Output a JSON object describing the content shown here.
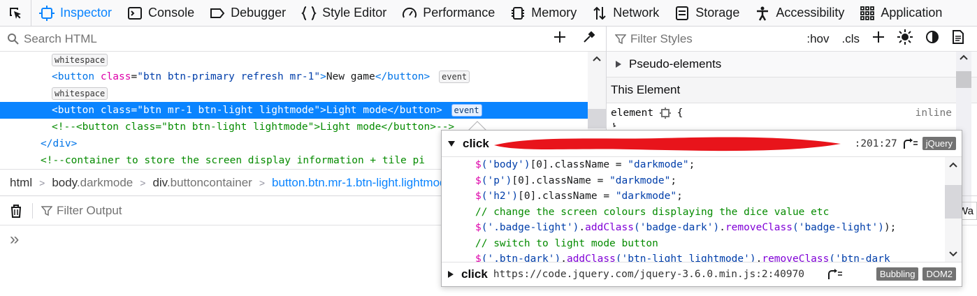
{
  "toolbar": {
    "tabs": [
      {
        "label": "Inspector",
        "icon": "inspector-icon",
        "selected": true
      },
      {
        "label": "Console",
        "icon": "console-icon"
      },
      {
        "label": "Debugger",
        "icon": "debugger-icon"
      },
      {
        "label": "Style Editor",
        "icon": "braces-icon"
      },
      {
        "label": "Performance",
        "icon": "gauge-icon"
      },
      {
        "label": "Memory",
        "icon": "chip-icon"
      },
      {
        "label": "Network",
        "icon": "arrows-icon"
      },
      {
        "label": "Storage",
        "icon": "storage-icon"
      },
      {
        "label": "Accessibility",
        "icon": "person-icon"
      },
      {
        "label": "Application",
        "icon": "grid-icon"
      }
    ]
  },
  "markup": {
    "search_placeholder": "Search HTML",
    "badge_whitespace": "whitespace",
    "badge_event": "event",
    "line2": {
      "tag_open": "<button ",
      "attr": "class",
      "eq": "=",
      "val": "\"btn btn-primary refresh mr-1\"",
      "close": ">",
      "text": "New game",
      "end": "</button>"
    },
    "line4": {
      "tag_open": "<button ",
      "attr": "class",
      "eq": "=",
      "val": "\"btn mr-1 btn-light lightmode\"",
      "close": ">",
      "text": "Light mode",
      "end": "</button>"
    },
    "line5": "<!--<button class=\"btn btn-light lightmode\">Light mode</button>-->",
    "line6": "</div>",
    "line7": "<!--container to store the screen display information + tile pi"
  },
  "breadcrumbs": {
    "html": "html",
    "body_tag": "body",
    "body_cls": ".darkmode",
    "div_tag": "div",
    "div_cls": ".buttoncontainer",
    "current": "button.btn.mr-1.btn-light.lightmod"
  },
  "rules": {
    "filter_placeholder": "Filter Styles",
    "hov": ":hov",
    "cls": ".cls",
    "pseudo": "Pseudo-elements",
    "this_element": "This Element",
    "element_selector": "element",
    "brace": "{",
    "inline": "inline",
    "brace_close": "}"
  },
  "console": {
    "filter_placeholder": "Filter Output",
    "prompt": "»",
    "cut_text": "Wa"
  },
  "tooltip": {
    "header": {
      "type": "click",
      "location": ":201:27",
      "tag": "jQuery"
    },
    "code": [
      [
        {
          "t": "$",
          "c": "jq"
        },
        {
          "t": "('body')",
          "c": "str"
        },
        {
          "t": "[0].className = ",
          "c": "txt"
        },
        {
          "t": "\"darkmode\"",
          "c": "str"
        },
        {
          "t": ";",
          "c": "txt"
        }
      ],
      [
        {
          "t": "$",
          "c": "jq"
        },
        {
          "t": "('p')",
          "c": "str"
        },
        {
          "t": "[0].className = ",
          "c": "txt"
        },
        {
          "t": "\"darkmode\"",
          "c": "str"
        },
        {
          "t": ";",
          "c": "txt"
        }
      ],
      [
        {
          "t": "$",
          "c": "jq"
        },
        {
          "t": "('h2')",
          "c": "str"
        },
        {
          "t": "[0].className = ",
          "c": "txt"
        },
        {
          "t": "\"darkmode\"",
          "c": "str"
        },
        {
          "t": ";",
          "c": "txt"
        }
      ],
      [
        {
          "t": "// change the screen colours displaying the dice value etc",
          "c": "comment"
        }
      ],
      [
        {
          "t": "$",
          "c": "jq"
        },
        {
          "t": "('.badge-light')",
          "c": "str"
        },
        {
          "t": ".",
          "c": "txt"
        },
        {
          "t": "addClass",
          "c": "fn"
        },
        {
          "t": "('badge-dark')",
          "c": "str"
        },
        {
          "t": ".",
          "c": "txt"
        },
        {
          "t": "removeClass",
          "c": "fn"
        },
        {
          "t": "('badge-light')",
          "c": "str"
        },
        {
          "t": ");",
          "c": "txt"
        }
      ],
      [
        {
          "t": "// switch to light mode button",
          "c": "comment"
        }
      ],
      [
        {
          "t": "$",
          "c": "jq"
        },
        {
          "t": "('.btn-dark')",
          "c": "str"
        },
        {
          "t": ".",
          "c": "txt"
        },
        {
          "t": "addClass",
          "c": "fn"
        },
        {
          "t": "('btn-light lightmode')",
          "c": "str"
        },
        {
          "t": ".",
          "c": "txt"
        },
        {
          "t": "removeClass",
          "c": "fn"
        },
        {
          "t": "('btn-dark",
          "c": "str"
        }
      ]
    ],
    "footer": {
      "type": "click",
      "location": "https://code.jquery.com/jquery-3.6.0.min.js:2:40970",
      "tag1": "Bubbling",
      "tag2": "DOM2"
    }
  },
  "colors": {
    "accent": "#0a84ff",
    "redaction": "#e8141b"
  }
}
